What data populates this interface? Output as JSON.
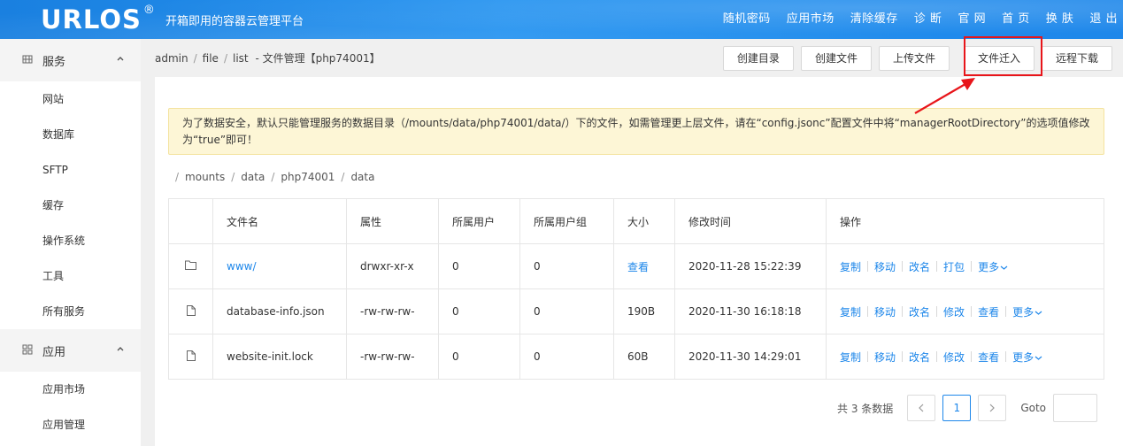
{
  "header": {
    "logo": "URLOS",
    "logo_reg": "®",
    "slogan": "开箱即用的容器云管理平台",
    "nav": [
      "随机密码",
      "应用市场",
      "清除缓存",
      "诊 断",
      "官 网",
      "首 页",
      "换 肤",
      "退 出"
    ]
  },
  "sidebar": {
    "groups": [
      {
        "icon": "services-icon",
        "label": "服务",
        "items": [
          "网站",
          "数据库",
          "SFTP",
          "缓存",
          "操作系统",
          "工具",
          "所有服务"
        ]
      },
      {
        "icon": "apps-grid-icon",
        "label": "应用",
        "items": [
          "应用市场",
          "应用管理"
        ]
      }
    ]
  },
  "breadcrumb": {
    "parts": [
      "admin",
      "file",
      "list"
    ],
    "title": "- 文件管理【php74001】"
  },
  "actions": [
    "创建目录",
    "创建文件",
    "上传文件",
    "文件迁入",
    "远程下载"
  ],
  "notice": "为了数据安全，默认只能管理服务的数据目录（/mounts/data/php74001/data/）下的文件，如需管理更上层文件，请在“config.jsonc”配置文件中将“managerRootDirectory”的选项值修改为“true”即可！",
  "path": [
    "mounts",
    "data",
    "php74001",
    "data"
  ],
  "table": {
    "headers": [
      "文件名",
      "属性",
      "所属用户",
      "所属用户组",
      "大小",
      "修改时间",
      "操作"
    ],
    "rows": [
      {
        "icon": "folder-icon",
        "name": "www/",
        "attr": "drwxr-xr-x",
        "user": "0",
        "group": "0",
        "size": "查看",
        "mtime": "2020-11-28 15:22:39",
        "ops": [
          "复制",
          "移动",
          "改名",
          "打包"
        ],
        "more": "更多"
      },
      {
        "icon": "file-icon",
        "name": "database-info.json",
        "attr": "-rw-rw-rw-",
        "user": "0",
        "group": "0",
        "size": "190B",
        "mtime": "2020-11-30 16:18:18",
        "ops": [
          "复制",
          "移动",
          "改名",
          "修改",
          "查看"
        ],
        "more": "更多"
      },
      {
        "icon": "file-icon",
        "name": "website-init.lock",
        "attr": "-rw-rw-rw-",
        "user": "0",
        "group": "0",
        "size": "60B",
        "mtime": "2020-11-30 14:29:01",
        "ops": [
          "复制",
          "移动",
          "改名",
          "修改",
          "查看"
        ],
        "more": "更多"
      }
    ]
  },
  "pager": {
    "total": "共 3 条数据",
    "current": "1",
    "goto_label": "Goto"
  },
  "colors": {
    "header": "#1e87ea",
    "link": "#1e87ea",
    "highlight": "#e8151a"
  }
}
